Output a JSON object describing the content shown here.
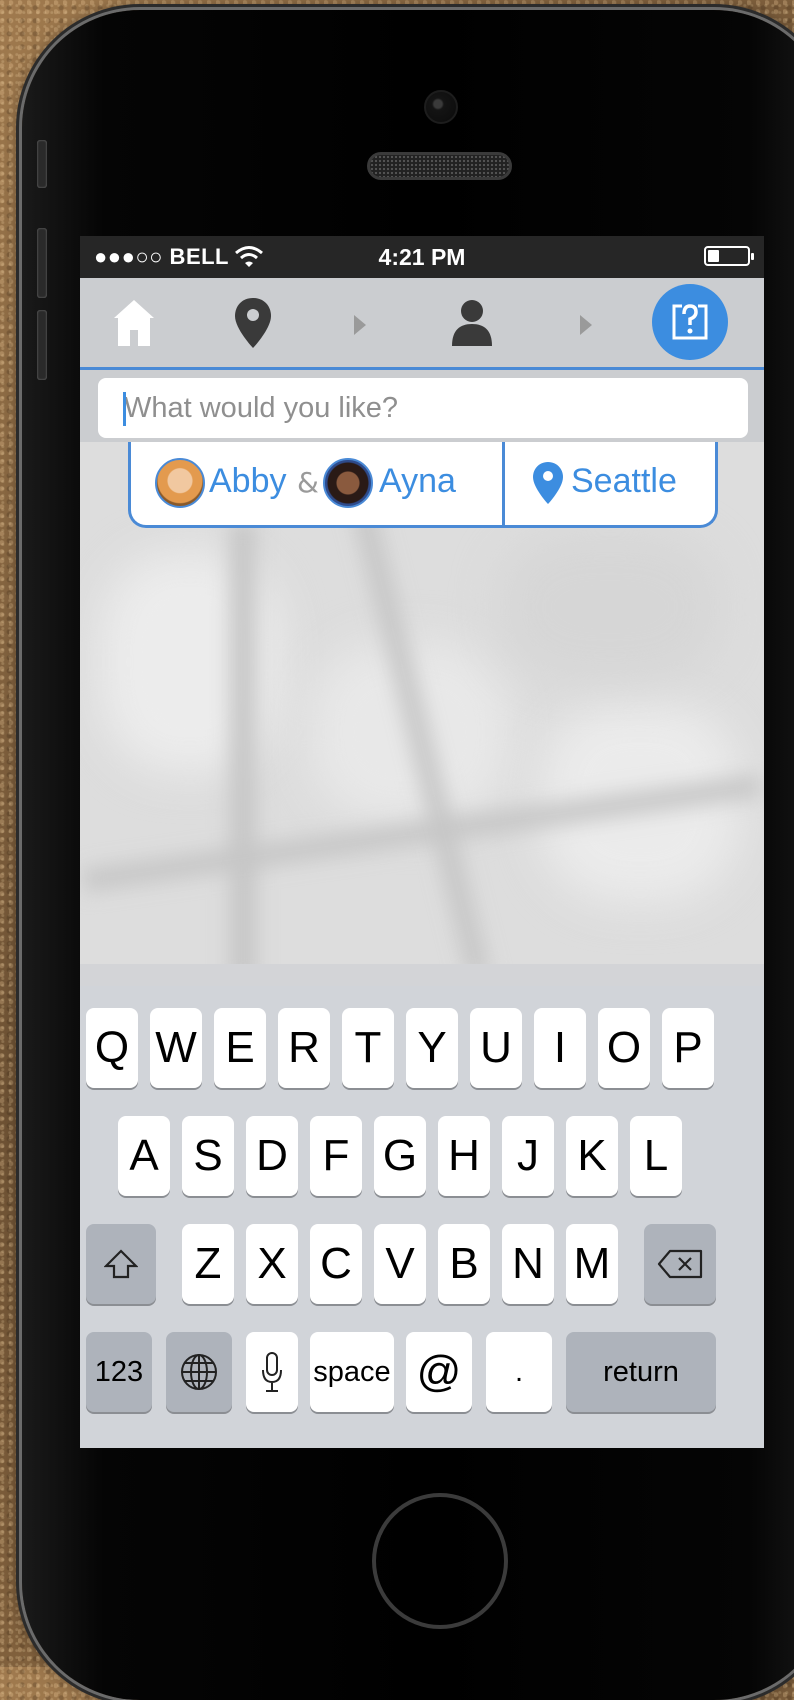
{
  "status_bar": {
    "carrier": "●●●○○ BELL",
    "time": "4:21 PM",
    "battery_level": 0.25,
    "wifi_icon": "wifi-icon"
  },
  "nav": {
    "icons": [
      "home-icon",
      "location-pin-icon",
      "chevron-right-icon",
      "person-icon",
      "chevron-right-icon",
      "help-question-icon"
    ],
    "accent_color": "#3c8de0"
  },
  "search": {
    "placeholder": "What would you like?",
    "value": ""
  },
  "context_chips": {
    "person1": "Abby",
    "separator": "&",
    "person2": "Ayna",
    "location": "Seattle"
  },
  "keyboard": {
    "row1": [
      "Q",
      "W",
      "E",
      "R",
      "T",
      "Y",
      "U",
      "I",
      "O",
      "P"
    ],
    "row2": [
      "A",
      "S",
      "D",
      "F",
      "G",
      "H",
      "J",
      "K",
      "L"
    ],
    "row3": [
      "Z",
      "X",
      "C",
      "V",
      "B",
      "N",
      "M"
    ],
    "numbers": "123",
    "space": "space",
    "at": "@",
    "dot": ".",
    "return": "return"
  }
}
